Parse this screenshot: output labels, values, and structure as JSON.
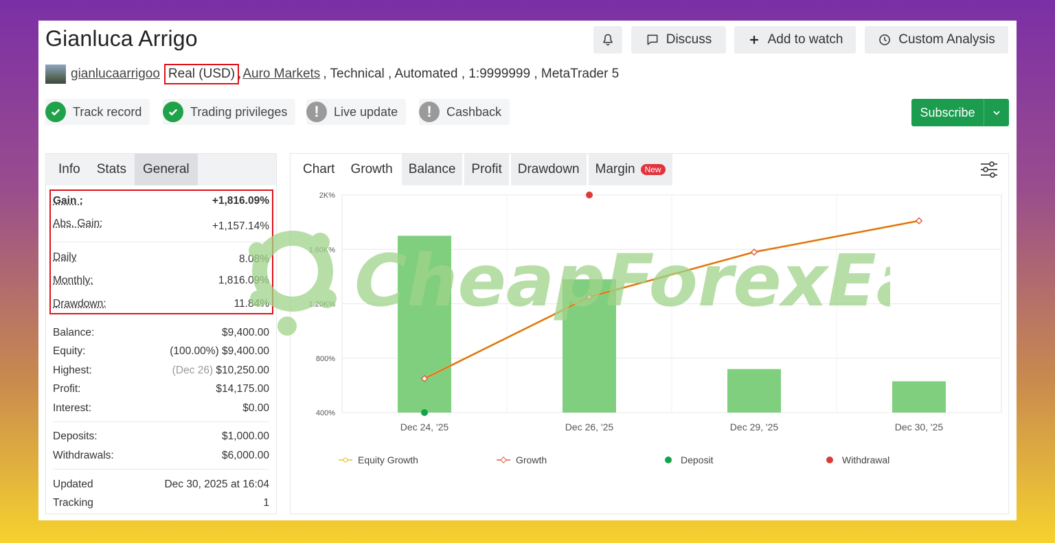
{
  "profile": {
    "name": "Gianluca Arrigo",
    "username": "gianlucaarrigoo",
    "account_type": "Real (USD)",
    "broker": "Auro Markets",
    "details": ", Technical , Automated , 1:9999999 , MetaTrader 5",
    "sep": ","
  },
  "header_buttons": {
    "discuss": "Discuss",
    "add_to_watch": "Add to watch",
    "custom_analysis": "Custom Analysis"
  },
  "badges": [
    {
      "label": "Track record",
      "status": "ok"
    },
    {
      "label": "Trading privileges",
      "status": "ok"
    },
    {
      "label": "Live update",
      "status": "warn"
    },
    {
      "label": "Cashback",
      "status": "warn"
    }
  ],
  "subscribe": {
    "label": "Subscribe"
  },
  "left_tabs": [
    "Info",
    "Stats",
    "General"
  ],
  "stats": {
    "gain_label": "Gain :",
    "gain_value": "+1,816.09%",
    "abs_gain_label": "Abs. Gain:",
    "abs_gain_value": "+1,157.14%",
    "daily_label": "Daily",
    "daily_value": "8.08%",
    "monthly_label": "Monthly:",
    "monthly_value": "1,816.09%",
    "drawdown_label": "Drawdown:",
    "drawdown_value": "11.84%",
    "balance_label": "Balance:",
    "balance_value": "$9,400.00",
    "equity_label": "Equity:",
    "equity_pct": "(100.00%)",
    "equity_value": "$9,400.00",
    "highest_label": "Highest:",
    "highest_date": "(Dec 26)",
    "highest_value": "$10,250.00",
    "profit_label": "Profit:",
    "profit_value": "$14,175.00",
    "interest_label": "Interest:",
    "interest_value": "$0.00",
    "deposits_label": "Deposits:",
    "deposits_value": "$1,000.00",
    "withdrawals_label": "Withdrawals:",
    "withdrawals_value": "$6,000.00",
    "updated_label": "Updated",
    "updated_value": "Dec 30, 2025 at 16:04",
    "tracking_label": "Tracking",
    "tracking_value": "1"
  },
  "chart_tabs": {
    "chart": "Chart",
    "growth": "Growth",
    "balance": "Balance",
    "profit": "Profit",
    "drawdown": "Drawdown",
    "margin": "Margin",
    "new_badge": "New"
  },
  "watermark": "CheapForexEa",
  "colors": {
    "accent_green": "#1b9c4f",
    "bar_green": "#7fcf7f",
    "growth_line": "#e05a3a",
    "equity_line": "#e8c21a",
    "deposit": "#14a34a",
    "withdrawal": "#dc3a3a",
    "highlight_red": "#e0101a"
  },
  "chart_data": {
    "type": "bar",
    "categories": [
      "Dec 24, '25",
      "Dec 26, '25",
      "Dec 29, '25",
      "Dec 30, '25"
    ],
    "y_tick_labels": [
      "400%",
      "800%",
      "1.20K%",
      "1.60K%",
      "2K%"
    ],
    "ylim": [
      400,
      2000
    ],
    "series": [
      {
        "name": "Equity Growth",
        "type": "line",
        "values": [
          650,
          1250,
          1580,
          1810
        ]
      },
      {
        "name": "Growth",
        "type": "line",
        "values": [
          650,
          1250,
          1580,
          1810
        ]
      },
      {
        "name": "Deposit",
        "type": "point",
        "values": [
          400,
          null,
          null,
          null
        ]
      },
      {
        "name": "Withdrawal",
        "type": "point",
        "values": [
          null,
          2000,
          null,
          null
        ]
      }
    ],
    "bars": [
      1700,
      1380,
      720,
      630
    ],
    "legend_position": "bottom",
    "grid": true
  }
}
